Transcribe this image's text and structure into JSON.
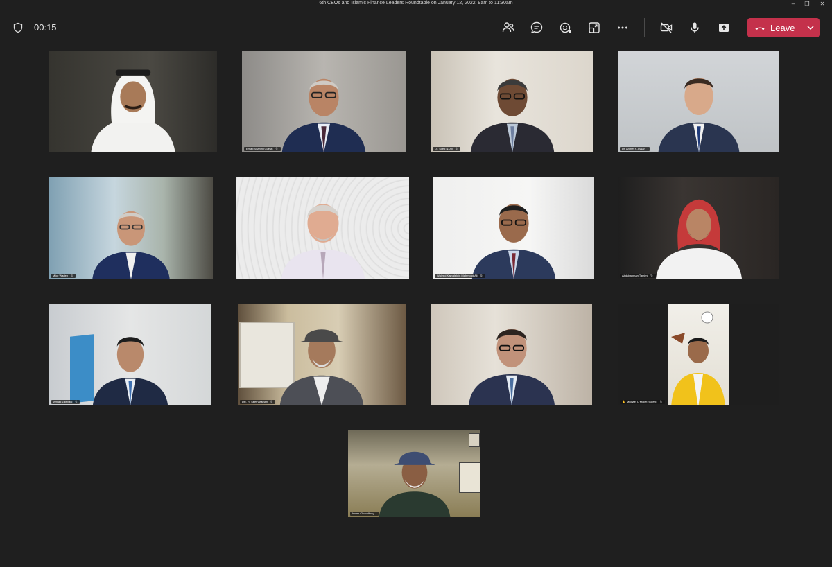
{
  "window": {
    "title": "6th CEOs and Islamic Finance Leaders Roundtable on January 12, 2022, 9am to 11:30am",
    "controls": [
      "–",
      "❐",
      "✕"
    ]
  },
  "toolbar": {
    "shield_icon": "shield-icon",
    "timer": "00:15",
    "buttons": [
      {
        "name": "people-icon"
      },
      {
        "name": "chat-icon"
      },
      {
        "name": "reactions-icon"
      },
      {
        "name": "rooms-icon"
      },
      {
        "name": "more-icon"
      },
      {
        "name": "camera-off-icon"
      },
      {
        "name": "mic-icon"
      },
      {
        "name": "share-icon"
      }
    ],
    "leave_label": "Leave",
    "leave_color": "#c4314b"
  },
  "participants": [
    {
      "name": "",
      "mic": ""
    },
    {
      "name": "Emad Shahin (Guest)",
      "mic": "🎙"
    },
    {
      "name": "Dr. Syed N. Ali",
      "mic": "🎙"
    },
    {
      "name": "Dr. Ahmet F. Aysan",
      "mic": ""
    },
    {
      "name": "Mike Wadeh",
      "mic": "🎙"
    },
    {
      "name": "",
      "mic": ""
    },
    {
      "name": "Waleed Kamaleldin Mahmoud Ali",
      "mic": "🎙"
    },
    {
      "name": "Abdulrahman Tamimi",
      "mic": "🎙"
    },
    {
      "name": "Amjad Zawyani",
      "mic": "🎙"
    },
    {
      "name": "DR. R. Seetharaman",
      "mic": "🎙"
    },
    {
      "name": "",
      "mic": ""
    },
    {
      "name": "Michael O'Mollet (Guest)",
      "mic": "🎙",
      "hand": "✋"
    },
    {
      "name": "Imran Chowdhury",
      "mic": ""
    }
  ]
}
